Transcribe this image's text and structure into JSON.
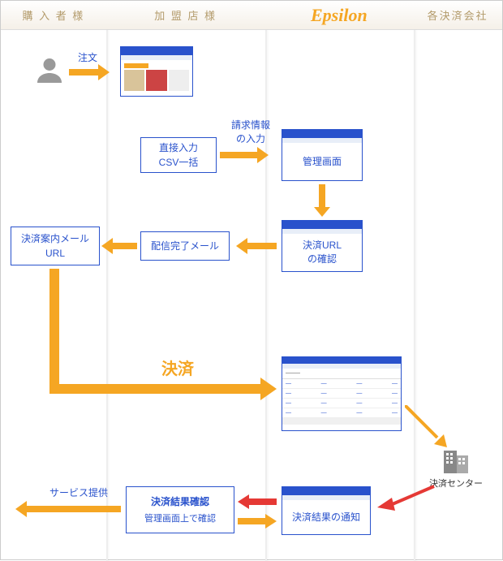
{
  "columns": {
    "purchaser": "購 入 者 様",
    "merchant": "加 盟 店 様",
    "epsilon": "Epsilon",
    "settlement_co": "各決済会社"
  },
  "flow_labels": {
    "order": "注文",
    "billing_input": "請求情報\nの入力",
    "settlement": "決済",
    "service_provide": "サービス提供"
  },
  "boxes": {
    "direct_csv": "直接入力\nCSV一括",
    "admin_screen": "管理画面",
    "settlement_url_confirm": "決済URL\nの確認",
    "delivery_done_mail": "配信完了メール",
    "settlement_guide_mail": "決済案内メール\nURL",
    "result_confirm_title": "決済結果確認",
    "result_confirm_sub": "管理画面上で確認",
    "result_notify": "決済結果の通知"
  },
  "settlement_center": "決済センター",
  "colors": {
    "orange": "#f5a623",
    "red": "#e53935",
    "blue": "#2952cc"
  }
}
